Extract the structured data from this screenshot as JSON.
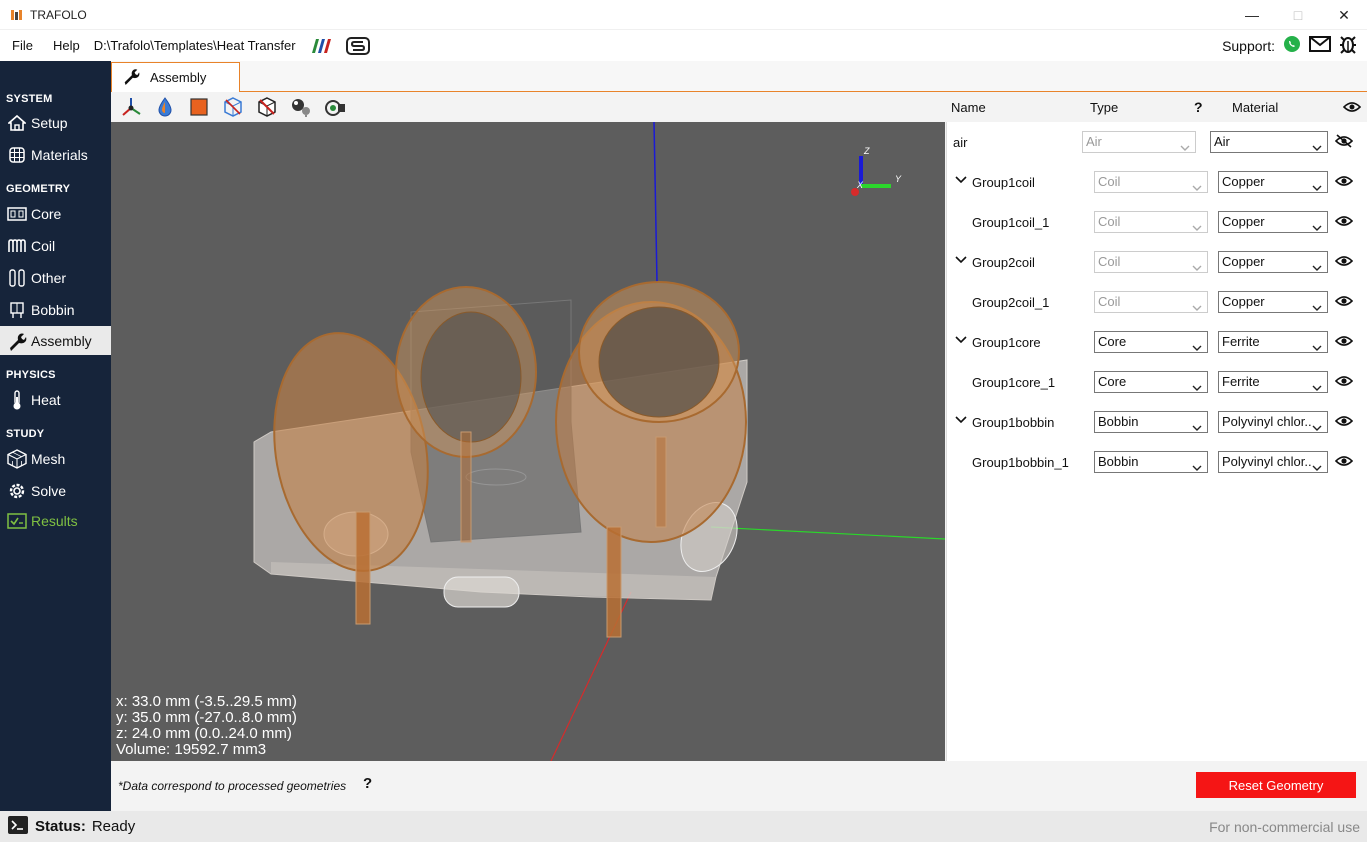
{
  "app": {
    "title": "TRAFOLO"
  },
  "menu": {
    "file": "File",
    "help": "Help",
    "path": "D:\\Trafolo\\Templates\\Heat Transfer"
  },
  "support": {
    "label": "Support:"
  },
  "sidebar": {
    "sections": {
      "system": "SYSTEM",
      "geometry": "GEOMETRY",
      "physics": "PHYSICS",
      "study": "STUDY"
    },
    "items": {
      "setup": "Setup",
      "materials": "Materials",
      "core": "Core",
      "coil": "Coil",
      "other": "Other",
      "bobbin": "Bobbin",
      "assembly": "Assembly",
      "heat": "Heat",
      "mesh": "Mesh",
      "solve": "Solve",
      "results": "Results"
    },
    "active": "assembly"
  },
  "tab": {
    "label": "Assembly"
  },
  "table": {
    "headers": {
      "name": "Name",
      "type": "Type",
      "help": "?",
      "material": "Material"
    },
    "rows": [
      {
        "name": "air",
        "type": "Air",
        "material": "Air",
        "group": false,
        "type_enabled": false,
        "visible": false
      },
      {
        "name": "Group1coil",
        "type": "Coil",
        "material": "Copper",
        "group": true,
        "type_enabled": false,
        "visible": true
      },
      {
        "name": "Group1coil_1",
        "type": "Coil",
        "material": "Copper",
        "group": false,
        "type_enabled": false,
        "visible": true
      },
      {
        "name": "Group2coil",
        "type": "Coil",
        "material": "Copper",
        "group": true,
        "type_enabled": false,
        "visible": true
      },
      {
        "name": "Group2coil_1",
        "type": "Coil",
        "material": "Copper",
        "group": false,
        "type_enabled": false,
        "visible": true
      },
      {
        "name": "Group1core",
        "type": "Core",
        "material": "Ferrite",
        "group": true,
        "type_enabled": true,
        "visible": true
      },
      {
        "name": "Group1core_1",
        "type": "Core",
        "material": "Ferrite",
        "group": false,
        "type_enabled": true,
        "visible": true
      },
      {
        "name": "Group1bobbin",
        "type": "Bobbin",
        "material": "Polyvinyl chlor..",
        "group": true,
        "type_enabled": true,
        "visible": true
      },
      {
        "name": "Group1bobbin_1",
        "type": "Bobbin",
        "material": "Polyvinyl chlor..",
        "group": false,
        "type_enabled": true,
        "visible": true
      }
    ]
  },
  "viewport": {
    "axes": {
      "z": "Z",
      "y": "Y",
      "x": "X"
    },
    "dims": {
      "x": "x: 33.0 mm (-3.5..29.5 mm)",
      "y": "y: 35.0 mm (-27.0..8.0 mm)",
      "z": "z: 24.0 mm (0.0..24.0 mm)",
      "volume": "Volume: 19592.7 mm3"
    }
  },
  "footer": {
    "note": "*Data correspond to processed geometries",
    "note_help": "?",
    "reset_button": "Reset Geometry"
  },
  "status": {
    "label": "Status:",
    "value": "Ready",
    "license": "For non-commercial use"
  },
  "colors": {
    "sidebar": "#16243a",
    "accent": "#e8832a",
    "reset": "#f51515",
    "results": "#7fc042"
  }
}
